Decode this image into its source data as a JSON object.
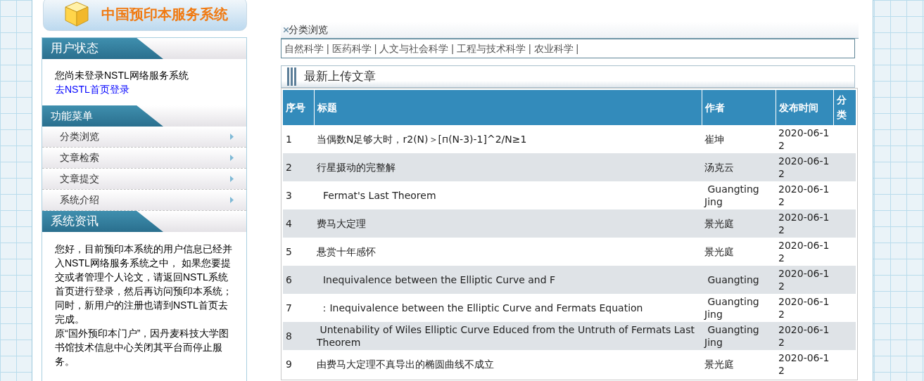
{
  "logo": {
    "title": "中国预印本服务系统"
  },
  "user_status": {
    "title": "用户状态",
    "message": "您尚未登录NSTL网络服务系统",
    "login_link": "去NSTL首页登录"
  },
  "function_menu": {
    "title": "功能菜单",
    "items": [
      {
        "label": "分类浏览"
      },
      {
        "label": "文章检索"
      },
      {
        "label": "文章提交"
      },
      {
        "label": "系统介绍"
      }
    ]
  },
  "system_news": {
    "title": "系统资讯",
    "paragraphs": [
      "您好，目前预印本系统的用户信息已经并入NSTL网络服务系统之中， 如果您要提交或者管理个人论文，请返回NSTL系统首页进行登录，然后再访问预印本系统；",
      "同时，新用户的注册也请到NSTL首页去完成。",
      "原“国外预印本门户”，因丹麦科技大学图书馆技术信息中心关闭其平台而停止服务。"
    ]
  },
  "breadcrumb": "分类浏览",
  "categories": {
    "separator": "|",
    "items": [
      "自然科学",
      "医药科学",
      "人文与社会科学",
      "工程与技术科学",
      "农业科学"
    ]
  },
  "latest": {
    "title": "最新上传文章"
  },
  "table": {
    "columns": [
      "序号",
      "标题",
      "作者",
      "发布时间",
      "分类"
    ],
    "rows": [
      {
        "no": "1",
        "title": "当偶数N足够大时，r2(N)＞[п(N-3)-1]^2/N≥1",
        "author": "崔坤",
        "date": "2020-06-12"
      },
      {
        "no": "2",
        "title": "行星摄动的完整解",
        "author": "汤克云",
        "date": "2020-06-12"
      },
      {
        "no": "3",
        "title": "  Fermat's Last Theorem",
        "author": " Guangting Jing",
        "date": "2020-06-12"
      },
      {
        "no": "4",
        "title": "费马大定理",
        "author": "景光庭",
        "date": "2020-06-12"
      },
      {
        "no": "5",
        "title": "悬赏十年感怀",
        "author": "景光庭",
        "date": "2020-06-12"
      },
      {
        "no": "6",
        "title": "  Inequivalence between the Elliptic Curve and F",
        "author": " Guangting",
        "date": "2020-06-12"
      },
      {
        "no": "7",
        "title": " ：Inequivalence between the Elliptic Curve and Fermats Equation",
        "author": " Guangting Jing",
        "date": "2020-06-12"
      },
      {
        "no": "8",
        "title": " Untenability of Wiles Elliptic Curve Educed from the Untruth of Fermats Last Theorem",
        "author": " Guangting Jing",
        "date": "2020-06-12"
      },
      {
        "no": "9",
        "title": "由费马大定理不真导出的椭圆曲线不成立",
        "author": "景光庭",
        "date": "2020-06-12"
      }
    ]
  }
}
